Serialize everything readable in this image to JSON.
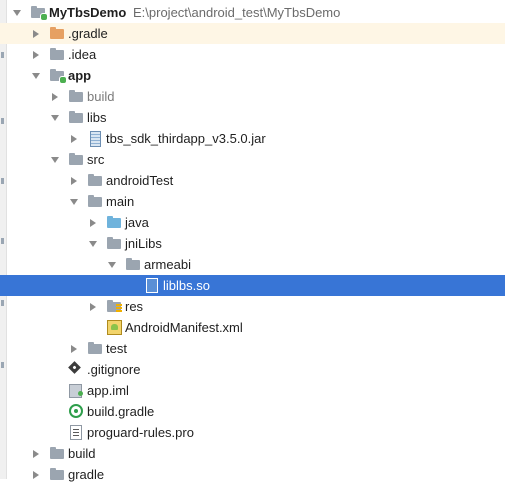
{
  "project": {
    "name": "MyTbsDemo",
    "path": "E:\\project\\android_test\\MyTbsDemo"
  },
  "tree": [
    {
      "label": "MyTbsDemo",
      "indent": 0,
      "arrow": "down",
      "icon": "module-folder-icon",
      "bold": true,
      "showPath": true
    },
    {
      "label": ".gradle",
      "indent": 1,
      "arrow": "right",
      "icon": "folder-orange-icon",
      "highlight": true
    },
    {
      "label": ".idea",
      "indent": 1,
      "arrow": "right",
      "icon": "folder-gray-icon"
    },
    {
      "label": "app",
      "indent": 1,
      "arrow": "down",
      "icon": "module-folder-icon",
      "bold": true
    },
    {
      "label": "build",
      "indent": 2,
      "arrow": "right",
      "icon": "folder-gray-icon",
      "muted": true
    },
    {
      "label": "libs",
      "indent": 2,
      "arrow": "down",
      "icon": "folder-gray-icon"
    },
    {
      "label": "tbs_sdk_thirdapp_v3.5.0.jar",
      "indent": 3,
      "arrow": "right",
      "icon": "jar-icon"
    },
    {
      "label": "src",
      "indent": 2,
      "arrow": "down",
      "icon": "folder-gray-icon"
    },
    {
      "label": "androidTest",
      "indent": 3,
      "arrow": "right",
      "icon": "folder-gray-icon"
    },
    {
      "label": "main",
      "indent": 3,
      "arrow": "down",
      "icon": "folder-gray-icon"
    },
    {
      "label": "java",
      "indent": 4,
      "arrow": "right",
      "icon": "folder-blue-icon"
    },
    {
      "label": "jniLibs",
      "indent": 4,
      "arrow": "down",
      "icon": "folder-gray-icon"
    },
    {
      "label": "armeabi",
      "indent": 5,
      "arrow": "down",
      "icon": "folder-gray-icon"
    },
    {
      "label": "liblbs.so",
      "indent": 6,
      "arrow": "none",
      "icon": "so-file-icon",
      "selected": true
    },
    {
      "label": "res",
      "indent": 4,
      "arrow": "right",
      "icon": "res-folder-icon"
    },
    {
      "label": "AndroidManifest.xml",
      "indent": 4,
      "arrow": "none",
      "icon": "manifest-icon"
    },
    {
      "label": "test",
      "indent": 3,
      "arrow": "right",
      "icon": "folder-gray-icon"
    },
    {
      "label": ".gitignore",
      "indent": 2,
      "arrow": "none",
      "icon": "git-icon"
    },
    {
      "label": "app.iml",
      "indent": 2,
      "arrow": "none",
      "icon": "iml-icon"
    },
    {
      "label": "build.gradle",
      "indent": 2,
      "arrow": "none",
      "icon": "gradle-icon"
    },
    {
      "label": "proguard-rules.pro",
      "indent": 2,
      "arrow": "none",
      "icon": "pro-file-icon"
    },
    {
      "label": "build",
      "indent": 1,
      "arrow": "right",
      "icon": "folder-gray-icon"
    },
    {
      "label": "gradle",
      "indent": 1,
      "arrow": "right",
      "icon": "folder-gray-icon"
    }
  ],
  "colors": {
    "selection": "#3875d6",
    "highlight": "#fef6e5"
  }
}
